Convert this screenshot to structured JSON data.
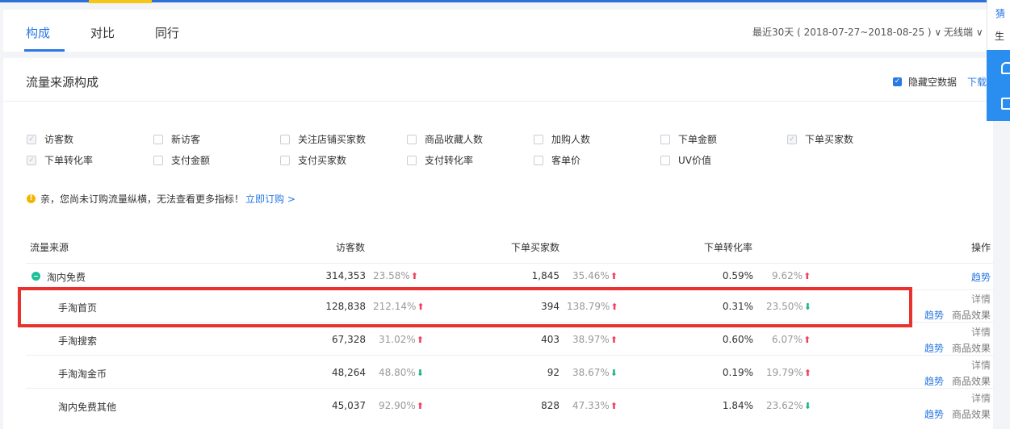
{
  "tabs": [
    {
      "label": "构成",
      "active": true
    },
    {
      "label": "对比",
      "active": false
    },
    {
      "label": "同行",
      "active": false
    }
  ],
  "date_range": "最近30天 ( 2018-07-27~2018-08-25 ) ∨",
  "device": "无线端 ∨",
  "section_title": "流量来源构成",
  "hide_empty_label": "隐藏空数据",
  "download_label": "下载",
  "metrics_row1": [
    {
      "label": "访客数",
      "checked": true
    },
    {
      "label": "新访客",
      "checked": false
    },
    {
      "label": "关注店铺买家数",
      "checked": false
    },
    {
      "label": "商品收藏人数",
      "checked": false
    },
    {
      "label": "加购人数",
      "checked": false
    },
    {
      "label": "下单金额",
      "checked": false
    },
    {
      "label": "下单买家数",
      "checked": true
    }
  ],
  "metrics_row2": [
    {
      "label": "下单转化率",
      "checked": true
    },
    {
      "label": "支付金额",
      "checked": false
    },
    {
      "label": "支付买家数",
      "checked": false
    },
    {
      "label": "支付转化率",
      "checked": false
    },
    {
      "label": "客单价",
      "checked": false
    },
    {
      "label": "UV价值",
      "checked": false
    }
  ],
  "notice": {
    "text": "亲，您尚未订购流量纵横，无法查看更多指标！",
    "link": "立即订购 >"
  },
  "table": {
    "headers": [
      "流量来源",
      "访客数",
      "下单买家数",
      "下单转化率",
      "操作"
    ],
    "rows": [
      {
        "name": "淘内免费",
        "visitors": "314,353",
        "visitors_chg": "23.58%",
        "visitors_dir": "up",
        "buyers": "1,845",
        "buyers_chg": "35.46%",
        "buyers_dir": "up",
        "rate": "0.59%",
        "rate_chg": "9.62%",
        "rate_dir": "up",
        "ops": [
          "趋势"
        ]
      },
      {
        "name": "手淘首页",
        "visitors": "128,838",
        "visitors_chg": "212.14%",
        "visitors_dir": "up",
        "buyers": "394",
        "buyers_chg": "138.79%",
        "buyers_dir": "up",
        "rate": "0.31%",
        "rate_chg": "23.50%",
        "rate_dir": "down",
        "ops": [
          "详情",
          "趋势",
          "商品效果"
        ]
      },
      {
        "name": "手淘搜索",
        "visitors": "67,328",
        "visitors_chg": "31.02%",
        "visitors_dir": "up",
        "buyers": "403",
        "buyers_chg": "38.97%",
        "buyers_dir": "up",
        "rate": "0.60%",
        "rate_chg": "6.07%",
        "rate_dir": "up",
        "ops": [
          "详情",
          "趋势",
          "商品效果"
        ]
      },
      {
        "name": "手淘淘金币",
        "visitors": "48,264",
        "visitors_chg": "48.80%",
        "visitors_dir": "down",
        "buyers": "92",
        "buyers_chg": "38.67%",
        "buyers_dir": "down",
        "rate": "0.19%",
        "rate_chg": "19.79%",
        "rate_dir": "up",
        "ops": [
          "详情",
          "趋势",
          "商品效果"
        ]
      },
      {
        "name": "淘内免费其他",
        "visitors": "45,037",
        "visitors_chg": "92.90%",
        "visitors_dir": "up",
        "buyers": "828",
        "buyers_chg": "47.33%",
        "buyers_dir": "up",
        "rate": "1.84%",
        "rate_chg": "23.62%",
        "rate_dir": "down",
        "ops": [
          "详情",
          "趋势",
          "商品效果"
        ]
      }
    ]
  },
  "side_panel": {
    "line1": "猜",
    "line2": "生"
  },
  "colors": {
    "accent": "#2a78e4",
    "up": "#f0405b",
    "down": "#19b48a",
    "highlight": "#e8322f"
  }
}
